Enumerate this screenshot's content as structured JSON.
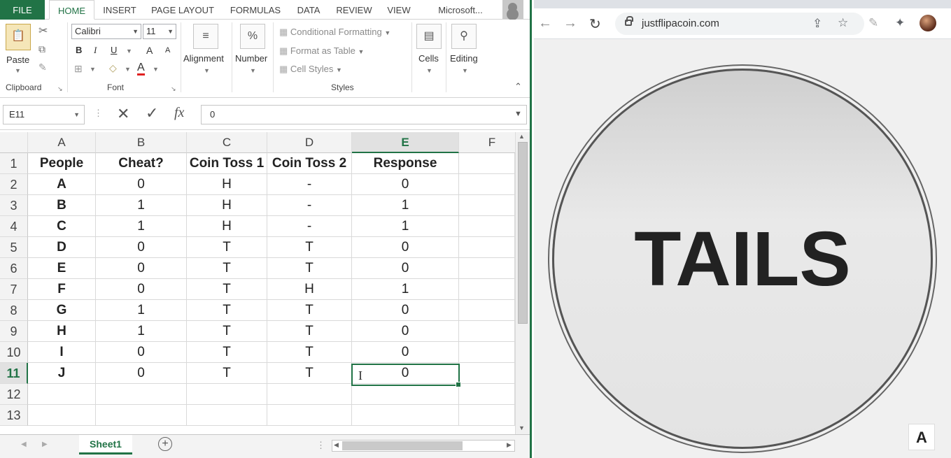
{
  "excel": {
    "tabs": [
      "FILE",
      "HOME",
      "INSERT",
      "PAGE LAYOUT",
      "FORMULAS",
      "DATA",
      "REVIEW",
      "VIEW",
      "Microsoft..."
    ],
    "clipboard": {
      "paste": "Paste",
      "label": "Clipboard"
    },
    "font": {
      "name": "Calibri",
      "size": "11",
      "bold": "B",
      "italic": "I",
      "underline": "U",
      "grow": "A",
      "shrink": "A",
      "color": "A",
      "label": "Font"
    },
    "alignment": "Alignment",
    "number": {
      "label": "Number",
      "icon": "%"
    },
    "styles": {
      "conditional": "Conditional Formatting",
      "format_table": "Format as Table",
      "cell_styles": "Cell Styles",
      "label": "Styles"
    },
    "cells": "Cells",
    "editing": "Editing",
    "namebox": "E11",
    "formula_icons": {
      "cancel": "✕",
      "enter": "✓",
      "fx": "fx"
    },
    "formula": "0",
    "columns": [
      "A",
      "B",
      "C",
      "D",
      "E",
      "F"
    ],
    "rows": [
      "1",
      "2",
      "3",
      "4",
      "5",
      "6",
      "7",
      "8",
      "9",
      "10",
      "11",
      "12",
      "13"
    ],
    "headers": [
      "People",
      "Cheat?",
      "Coin Toss 1",
      "Coin Toss 2",
      "Response"
    ],
    "data": [
      [
        "A",
        "0",
        "H",
        "-",
        "0"
      ],
      [
        "B",
        "1",
        "H",
        "-",
        "1"
      ],
      [
        "C",
        "1",
        "H",
        "-",
        "1"
      ],
      [
        "D",
        "0",
        "T",
        "T",
        "0"
      ],
      [
        "E",
        "0",
        "T",
        "T",
        "0"
      ],
      [
        "F",
        "0",
        "T",
        "H",
        "1"
      ],
      [
        "G",
        "1",
        "T",
        "T",
        "0"
      ],
      [
        "H",
        "1",
        "T",
        "T",
        "0"
      ],
      [
        "I",
        "0",
        "T",
        "T",
        "0"
      ],
      [
        "J",
        "0",
        "T",
        "T",
        "0"
      ]
    ],
    "sheet": "Sheet1",
    "accent": "#217346"
  },
  "browser": {
    "url": "justflipacoin.com",
    "coin_text": "TAILS",
    "logo": "A"
  }
}
